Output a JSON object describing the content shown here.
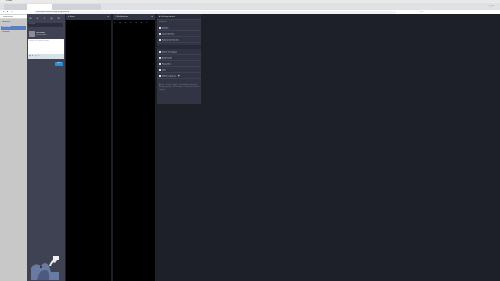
{
  "browser": {
    "menubar_app": "Vivaldi",
    "tabs": [
      {
        "label": "Mastodon"
      },
      {
        "label": "Mastodon"
      },
      {
        "label": "Mastodon"
      },
      {
        "label": "Mastodon"
      }
    ],
    "url": "mastodon.social/web/getting-started",
    "bookmarks_label": "Bookmarks"
  },
  "os_sidebar": {
    "items": [
      {
        "label": "Favorites"
      },
      {
        "label": "Mastodon"
      },
      {
        "label": "Desktop"
      }
    ]
  },
  "compose": {
    "search_placeholder": "Search",
    "display_name": "Username",
    "handle": "@username",
    "textarea_placeholder": "What is on your mind?",
    "toot_label": "Toot!"
  },
  "columns": {
    "home_title": "Home",
    "notifications_title": "Notifications"
  },
  "getting_started": {
    "title": "Getting started",
    "section_label": "Discover",
    "items": [
      {
        "label": "Explore"
      },
      {
        "label": "Local timeline"
      },
      {
        "label": "Federated timeline"
      },
      {
        "label": "Direct messages"
      },
      {
        "label": "Bookmarks"
      },
      {
        "label": "Favourites"
      },
      {
        "label": "Lists"
      },
      {
        "label": "Follow requests"
      }
    ],
    "footer": "About · Invite people · Keyboard shortcuts · Privacy policy · Developers · Terms of service · Logout"
  },
  "colors": {
    "app_bg": "#1e2028",
    "panel": "#313543",
    "compose_bg": "#3e4252",
    "accent": "#2b90d9",
    "column_bg": "#000000"
  }
}
